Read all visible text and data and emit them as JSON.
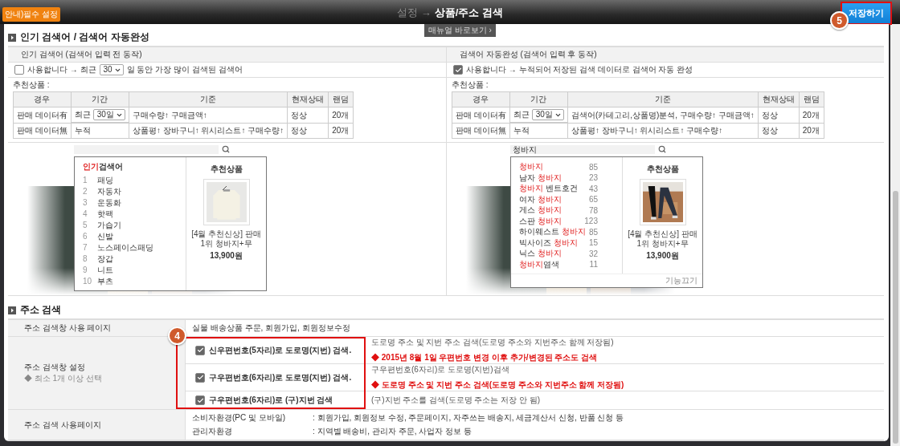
{
  "header": {
    "notice_badge": "안내)필수 설정",
    "title_prefix": "설정 →",
    "title": "상품/주소 검색",
    "save_button": "저장하기",
    "save_step": "5",
    "manual_link": "매뉴얼 바로보기 ›"
  },
  "search_section": {
    "title": "인기 검색어 / 검색어 자동완성",
    "panels": [
      {
        "kind": "popular",
        "heading": "인기 검색어 (검색어 입력 전 동작)",
        "checked": false,
        "option_before": "사용합니다 → 최근",
        "days": "30",
        "option_after": "일 동안 가장 많이 검색된 검색어",
        "rec_label": "추천상품 :",
        "columns": [
          "경우",
          "기간",
          "기준",
          "현재상태",
          "랜덤"
        ],
        "rows": [
          {
            "case": "판매 데이터有",
            "period": "최근",
            "period_select": "30일",
            "criteria": "구매수량↑ 구매금액↑",
            "status": "정상",
            "random": "20개"
          },
          {
            "case": "판매 데이터無",
            "period": "누적",
            "criteria": "상품평↑ 장바구니↑ 위시리스트↑ 구매수량↑",
            "status": "정상",
            "random": "20개"
          }
        ],
        "preview": {
          "list_title_highlight": "인기",
          "list_title_rest": "검색어",
          "keywords": [
            {
              "rank": "1",
              "text": "패딩"
            },
            {
              "rank": "2",
              "text": "자동차"
            },
            {
              "rank": "3",
              "text": "운동화"
            },
            {
              "rank": "4",
              "text": "핫팩"
            },
            {
              "rank": "5",
              "text": "가습기"
            },
            {
              "rank": "6",
              "text": "신발"
            },
            {
              "rank": "7",
              "text": "노스페이스패딩"
            },
            {
              "rank": "8",
              "text": "장갑"
            },
            {
              "rank": "9",
              "text": "니트"
            },
            {
              "rank": "10",
              "text": "부츠"
            }
          ],
          "rec_title": "추천상품",
          "product_name": "[4월 추천신상] 판매 1위 청바지+무",
          "price": "13,900원"
        }
      },
      {
        "kind": "autocomplete",
        "heading": "검색어 자동완성 (검색어 입력 후 동작)",
        "checked": true,
        "option_before": "사용합니다 → 누적되어 저장된 검색 데이터로 검색어 자동 완성",
        "rec_label": "추천상품 :",
        "columns": [
          "경우",
          "기간",
          "기준",
          "현재상태",
          "랜덤"
        ],
        "rows": [
          {
            "case": "판매 데이터有",
            "period": "최근",
            "period_select": "30일",
            "criteria": "검색어(카테고리,상품명)분석, 구매수량↑ 구매금액↑",
            "status": "정상",
            "random": "20개"
          },
          {
            "case": "판매 데이터無",
            "period": "누적",
            "criteria": "상품평↑ 장바구니↑ 위시리스트↑ 구매수량↑",
            "status": "정상",
            "random": "20개"
          }
        ],
        "preview": {
          "search_value": "청바지",
          "suggestions": [
            {
              "keyword": "청바지",
              "count": "85"
            },
            {
              "before": "남자 ",
              "keyword": "청바지",
              "count": "23"
            },
            {
              "keyword": "청바지",
              "after": " 벤트호건",
              "count": "43"
            },
            {
              "before": "여자 ",
              "keyword": "청바지",
              "count": "65"
            },
            {
              "before": "게스 ",
              "keyword": "청바지",
              "count": "78"
            },
            {
              "before": "스판 ",
              "keyword": "청바지",
              "count": "123"
            },
            {
              "before": "하이웨스트 ",
              "keyword": "청바지",
              "count": "85"
            },
            {
              "before": "빅사이즈 ",
              "keyword": "청바지",
              "count": "15"
            },
            {
              "before": "닉스 ",
              "keyword": "청바지",
              "count": "32"
            },
            {
              "keyword": "청바지",
              "after": "염색",
              "count": "11"
            }
          ],
          "rec_title": "추천상품",
          "product_name": "[4월 추천신상] 판매 1위 청바지+무",
          "price": "13,900원",
          "footer_link": "기능끄기"
        }
      }
    ]
  },
  "address_section": {
    "title": "주소 검색",
    "rows": [
      {
        "kind": "text",
        "label": "주소 검색창 사용 페이지",
        "value": "실물 배송상품 주문, 회원가입, 회원정보수정"
      },
      {
        "kind": "options",
        "label": "주소 검색창 설정",
        "note": "◆ 최소 1개 이상 선택",
        "step": "4",
        "options": [
          {
            "label": "신우편번호(5자리)로 도로명(지번) 검색.",
            "checked": true,
            "descriptions": [
              {
                "kind": "note",
                "text": "도로명 주소 및 지번 주소 검색(도로명 주소와 지번주소 함께 저장됨)"
              },
              {
                "kind": "warning",
                "text": "◆ 2015년 8월 1일 우편번호 변경 이후 추가/변경된 주소도 검색"
              }
            ]
          },
          {
            "label": "구우편번호(6자리)로 도로명(지번) 검색.",
            "checked": true,
            "descriptions": [
              {
                "kind": "note",
                "text": "구우편번호(6자리)로 도로명(지번)검색"
              },
              {
                "kind": "warning",
                "text": "◆ 도로명 주소 및 지번 주소 검색(도로명 주소와 지번주소 함께 저장됨)"
              }
            ]
          },
          {
            "label": "구우편번호(6자리)로 (구)지번 검색",
            "checked": true,
            "descriptions": [
              {
                "kind": "note",
                "text": "(구)지번 주소를 검색(도로명 주소는 저장 안 됨)"
              }
            ]
          }
        ]
      },
      {
        "kind": "usage",
        "label": "주소 검색 사용페이지",
        "lines": [
          {
            "env": "소비자환경(PC 및 모바일)",
            "pages": ": 회원가입, 회원정보 수정, 주문페이지, 자주쓰는 배송지, 세금계산서 신청, 반품 신청 등"
          },
          {
            "env": "관리자환경",
            "pages": ": 지역별 배송비, 관리자 주문, 사업자 정보 등"
          }
        ]
      }
    ]
  }
}
